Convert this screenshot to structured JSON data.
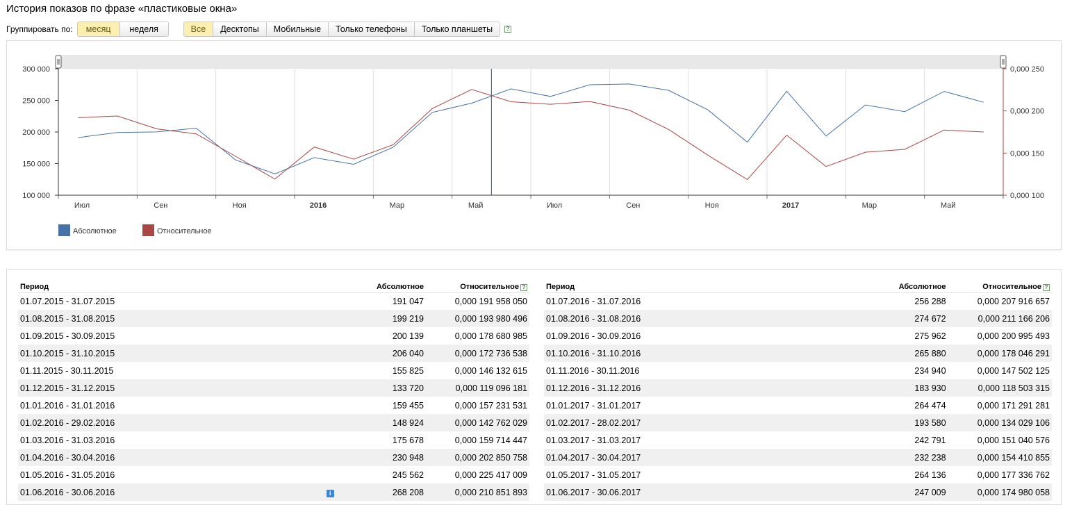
{
  "page": {
    "title": "История показов по фразе «пластиковые окна»"
  },
  "controls": {
    "group_label": "Группировать по:",
    "periods": [
      {
        "label": "месяц",
        "active": true
      },
      {
        "label": "неделя",
        "active": false
      }
    ],
    "devices": [
      {
        "label": "Все",
        "active": true
      },
      {
        "label": "Десктопы",
        "active": false
      },
      {
        "label": "Мобильные",
        "active": false
      },
      {
        "label": "Только телефоны",
        "active": false
      },
      {
        "label": "Только планшеты",
        "active": false
      }
    ],
    "help_icon": "question-icon",
    "help_glyph": "?"
  },
  "chart_data": {
    "type": "line",
    "categories": [
      "Июл 2015",
      "Авг 2015",
      "Сен 2015",
      "Окт 2015",
      "Ноя 2015",
      "Дек 2015",
      "Янв 2016",
      "Фев 2016",
      "Мар 2016",
      "Апр 2016",
      "Май 2016",
      "Июн 2016",
      "Июл 2016",
      "Авг 2016",
      "Сен 2016",
      "Окт 2016",
      "Ноя 2016",
      "Дек 2016",
      "Янв 2017",
      "Фев 2017",
      "Мар 2017",
      "Апр 2017",
      "Май 2017",
      "Июн 2017"
    ],
    "x_tick_labels": [
      "Июл",
      "Сен",
      "Ноя",
      "2016",
      "Мар",
      "Май",
      "Июл",
      "Сен",
      "Ноя",
      "2017",
      "Мар",
      "Май"
    ],
    "series": [
      {
        "name": "Абсолютное",
        "color": "#4572a7",
        "axis": "left",
        "values": [
          191047,
          199219,
          200139,
          206040,
          155825,
          133720,
          159455,
          148924,
          175678,
          230948,
          245562,
          268208,
          256288,
          274672,
          275962,
          265880,
          234940,
          183930,
          264474,
          193580,
          242791,
          232238,
          264136,
          247009
        ]
      },
      {
        "name": "Относительное",
        "color": "#aa4643",
        "axis": "right",
        "values": [
          0.00019195805,
          0.000193980496,
          0.000178680985,
          0.000172736538,
          0.000146132615,
          0.000119096181,
          0.000157231531,
          0.000142762029,
          0.000159714447,
          0.000202850758,
          0.000225417009,
          0.000210851893,
          0.000207916657,
          0.000211166206,
          0.000200995493,
          0.000178046291,
          0.000147502125,
          0.000118503315,
          0.000171291281,
          0.000134029106,
          0.000151040576,
          0.000154410855,
          0.000177336762,
          0.000174980058
        ]
      }
    ],
    "y_left": {
      "ticks": [
        "300 000",
        "250 000",
        "200 000",
        "150 000",
        "100 000"
      ],
      "ylim": [
        100000,
        300000
      ]
    },
    "y_right": {
      "ticks": [
        "0,000 250",
        "0,000 200",
        "0,000 150",
        "0,000 100"
      ],
      "ylim": [
        0.0001,
        0.00025
      ]
    },
    "crosshair_category": "Июн 2016",
    "grid": true,
    "legend_position": "bottom-left"
  },
  "table": {
    "headers": {
      "period": "Период",
      "absolute": "Абсолютное",
      "relative": "Относительное"
    },
    "info_icon": "i",
    "left": [
      {
        "period": "01.07.2015 - 31.07.2015",
        "absolute": "191 047",
        "relative": "0,000 191 958 050"
      },
      {
        "period": "01.08.2015 - 31.08.2015",
        "absolute": "199 219",
        "relative": "0,000 193 980 496"
      },
      {
        "period": "01.09.2015 - 30.09.2015",
        "absolute": "200 139",
        "relative": "0,000 178 680 985"
      },
      {
        "period": "01.10.2015 - 31.10.2015",
        "absolute": "206 040",
        "relative": "0,000 172 736 538"
      },
      {
        "period": "01.11.2015 - 30.11.2015",
        "absolute": "155 825",
        "relative": "0,000 146 132 615"
      },
      {
        "period": "01.12.2015 - 31.12.2015",
        "absolute": "133 720",
        "relative": "0,000 119 096 181"
      },
      {
        "period": "01.01.2016 - 31.01.2016",
        "absolute": "159 455",
        "relative": "0,000 157 231 531"
      },
      {
        "period": "01.02.2016 - 29.02.2016",
        "absolute": "148 924",
        "relative": "0,000 142 762 029"
      },
      {
        "period": "01.03.2016 - 31.03.2016",
        "absolute": "175 678",
        "relative": "0,000 159 714 447"
      },
      {
        "period": "01.04.2016 - 30.04.2016",
        "absolute": "230 948",
        "relative": "0,000 202 850 758"
      },
      {
        "period": "01.05.2016 - 31.05.2016",
        "absolute": "245 562",
        "relative": "0,000 225 417 009"
      },
      {
        "period": "01.06.2016 - 30.06.2016",
        "absolute": "268 208",
        "relative": "0,000 210 851 893",
        "info": true
      }
    ],
    "right": [
      {
        "period": "01.07.2016 - 31.07.2016",
        "absolute": "256 288",
        "relative": "0,000 207 916 657"
      },
      {
        "period": "01.08.2016 - 31.08.2016",
        "absolute": "274 672",
        "relative": "0,000 211 166 206"
      },
      {
        "period": "01.09.2016 - 30.09.2016",
        "absolute": "275 962",
        "relative": "0,000 200 995 493"
      },
      {
        "period": "01.10.2016 - 31.10.2016",
        "absolute": "265 880",
        "relative": "0,000 178 046 291"
      },
      {
        "period": "01.11.2016 - 30.11.2016",
        "absolute": "234 940",
        "relative": "0,000 147 502 125"
      },
      {
        "period": "01.12.2016 - 31.12.2016",
        "absolute": "183 930",
        "relative": "0,000 118 503 315"
      },
      {
        "period": "01.01.2017 - 31.01.2017",
        "absolute": "264 474",
        "relative": "0,000 171 291 281"
      },
      {
        "period": "01.02.2017 - 28.02.2017",
        "absolute": "193 580",
        "relative": "0,000 134 029 106"
      },
      {
        "period": "01.03.2017 - 31.03.2017",
        "absolute": "242 791",
        "relative": "0,000 151 040 576"
      },
      {
        "period": "01.04.2017 - 30.04.2017",
        "absolute": "232 238",
        "relative": "0,000 154 410 855"
      },
      {
        "period": "01.05.2017 - 31.05.2017",
        "absolute": "264 136",
        "relative": "0,000 177 336 762"
      },
      {
        "period": "01.06.2017 - 30.06.2017",
        "absolute": "247 009",
        "relative": "0,000 174 980 058"
      }
    ]
  }
}
